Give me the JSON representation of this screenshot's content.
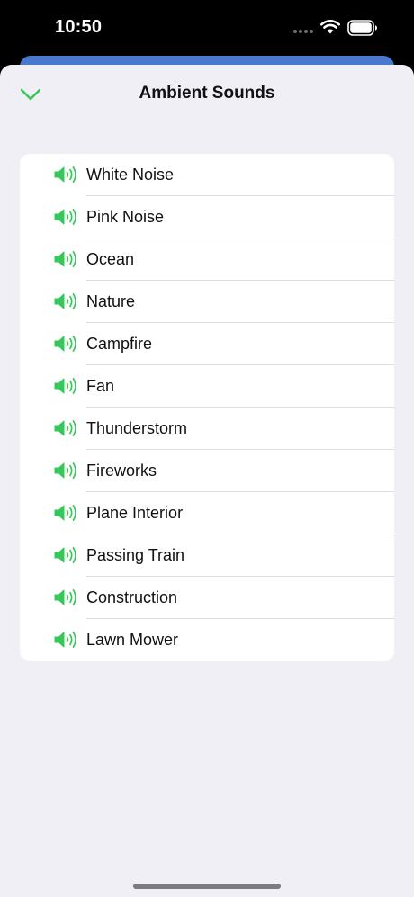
{
  "status_bar": {
    "time": "10:50"
  },
  "sheet": {
    "title": "Ambient Sounds",
    "collapse_icon": "chevron-down-icon"
  },
  "sounds": [
    {
      "label": "White Noise",
      "icon": "speaker-wave-icon"
    },
    {
      "label": "Pink Noise",
      "icon": "speaker-wave-icon"
    },
    {
      "label": "Ocean",
      "icon": "speaker-wave-icon"
    },
    {
      "label": "Nature",
      "icon": "speaker-wave-icon"
    },
    {
      "label": "Campfire",
      "icon": "speaker-wave-icon"
    },
    {
      "label": "Fan",
      "icon": "speaker-wave-icon"
    },
    {
      "label": "Thunderstorm",
      "icon": "speaker-wave-icon"
    },
    {
      "label": "Fireworks",
      "icon": "speaker-wave-icon"
    },
    {
      "label": "Plane Interior",
      "icon": "speaker-wave-icon"
    },
    {
      "label": "Passing Train",
      "icon": "speaker-wave-icon"
    },
    {
      "label": "Construction",
      "icon": "speaker-wave-icon"
    },
    {
      "label": "Lawn Mower",
      "icon": "speaker-wave-icon"
    }
  ],
  "colors": {
    "accent_green": "#34c759",
    "sheet_background": "#f0eff5",
    "behind_card_blue": "#4a78cf"
  }
}
